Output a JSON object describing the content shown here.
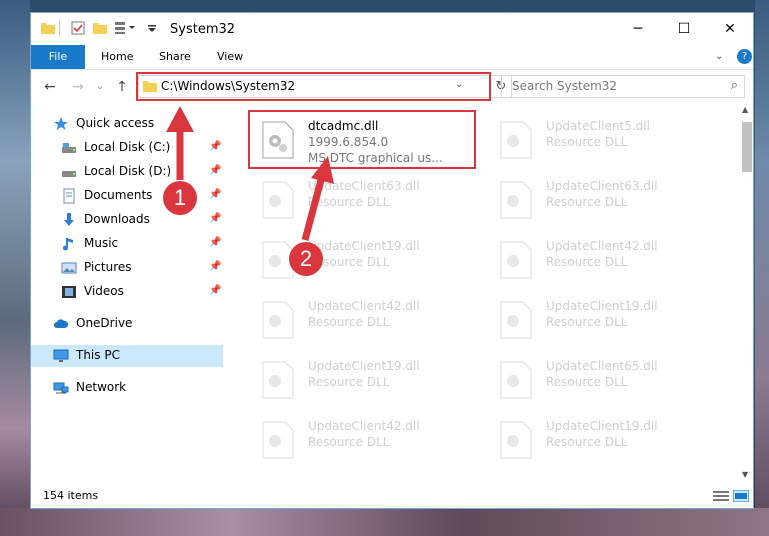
{
  "window": {
    "title": "System32"
  },
  "ribbon": {
    "file": "File",
    "home": "Home",
    "share": "Share",
    "view": "View"
  },
  "address": {
    "path": "C:\\Windows\\System32"
  },
  "search": {
    "placeholder": "Search System32"
  },
  "sidebar": {
    "items": [
      {
        "label": "Quick access",
        "icon": "star-icon"
      },
      {
        "label": "Local Disk (C:)",
        "icon": "drive-icon"
      },
      {
        "label": "Local Disk (D:)",
        "icon": "drive-icon"
      },
      {
        "label": "Documents",
        "icon": "documents-icon"
      },
      {
        "label": "Downloads",
        "icon": "download-icon"
      },
      {
        "label": "Music",
        "icon": "music-icon"
      },
      {
        "label": "Pictures",
        "icon": "pictures-icon"
      },
      {
        "label": "Videos",
        "icon": "videos-icon"
      },
      {
        "label": "OneDrive",
        "icon": "cloud-icon"
      },
      {
        "label": "This PC",
        "icon": "computer-icon"
      },
      {
        "label": "Network",
        "icon": "network-icon"
      }
    ]
  },
  "files": [
    {
      "name": "dtcadmc.dll",
      "version": "1999.6.854.0",
      "desc": "MS DTC graphical us..."
    },
    {
      "name": "UpdateClient5.dll",
      "desc": "Resource DLL"
    },
    {
      "name": "UpdateClient63.dll",
      "desc": "Resource DLL"
    },
    {
      "name": "UpdateClient63.dll",
      "desc": "Resource DLL"
    },
    {
      "name": "UpdateClient19.dll",
      "desc": "Resource DLL"
    },
    {
      "name": "UpdateClient42.dll",
      "desc": "Resource DLL"
    },
    {
      "name": "UpdateClient42.dll",
      "desc": "Resource DLL"
    },
    {
      "name": "UpdateClient19.dll",
      "desc": "Resource DLL"
    },
    {
      "name": "UpdateClient19.dll",
      "desc": "Resource DLL"
    },
    {
      "name": "UpdateClient65.dll",
      "desc": "Resource DLL"
    },
    {
      "name": "UpdateClient42.dll",
      "desc": "Resource DLL"
    },
    {
      "name": "UpdateClient19.dll",
      "desc": "Resource DLL"
    }
  ],
  "status": {
    "items": "154 items"
  },
  "callouts": {
    "one": "1",
    "two": "2"
  },
  "colors": {
    "accent": "#1979ca",
    "highlight": "#d9363e",
    "selected": "#cce8ff"
  }
}
